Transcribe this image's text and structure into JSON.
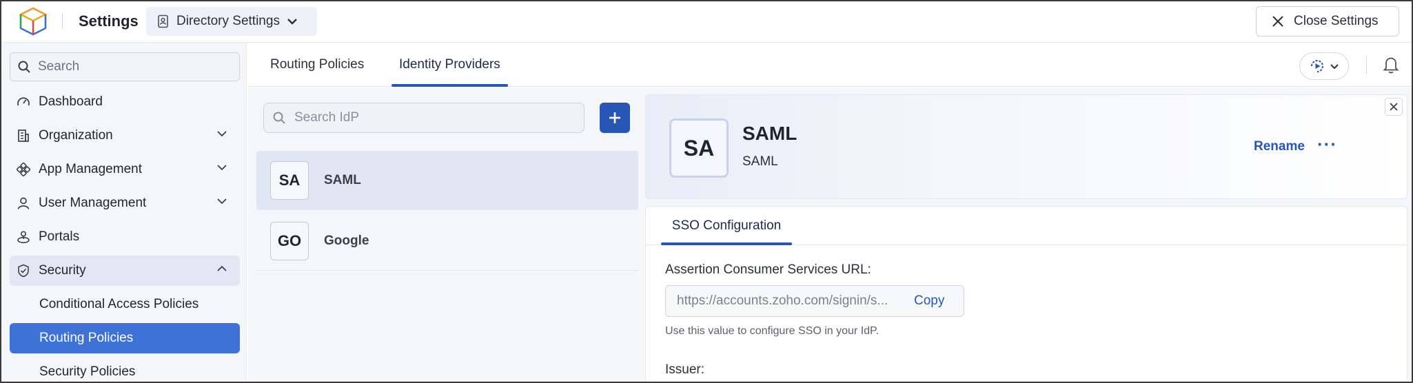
{
  "header": {
    "app_title": "Settings",
    "directory_label": "Directory Settings",
    "close_label": "Close Settings"
  },
  "sidebar": {
    "search_placeholder": "Search",
    "items": [
      {
        "label": "Dashboard",
        "icon": "gauge-icon"
      },
      {
        "label": "Organization",
        "icon": "building-icon"
      },
      {
        "label": "App Management",
        "icon": "apps-icon"
      },
      {
        "label": "User Management",
        "icon": "user-icon"
      },
      {
        "label": "Portals",
        "icon": "portal-icon"
      },
      {
        "label": "Security",
        "icon": "shield-icon"
      }
    ],
    "security_sub": [
      {
        "label": "Conditional Access Policies"
      },
      {
        "label": "Routing Policies"
      },
      {
        "label": "Security Policies"
      }
    ]
  },
  "tabs": [
    {
      "label": "Routing Policies"
    },
    {
      "label": "Identity Providers"
    }
  ],
  "idp_list": {
    "search_placeholder": "Search IdP",
    "items": [
      {
        "initials": "SA",
        "name": "SAML"
      },
      {
        "initials": "GO",
        "name": "Google"
      }
    ]
  },
  "detail": {
    "initials": "SA",
    "title": "SAML",
    "subtitle": "SAML",
    "rename_label": "Rename",
    "more_label": "···",
    "tab_label": "SSO Configuration",
    "acs_label": "Assertion Consumer Services URL:",
    "acs_value": "https://accounts.zoho.com/signin/s...",
    "copy_label": "Copy",
    "acs_hint": "Use this value to configure SSO in your IdP.",
    "issuer_label": "Issuer:"
  },
  "colors": {
    "accent": "#2856b6",
    "selected_nav": "#3f72d6",
    "selected_row": "#e1e6f4"
  }
}
